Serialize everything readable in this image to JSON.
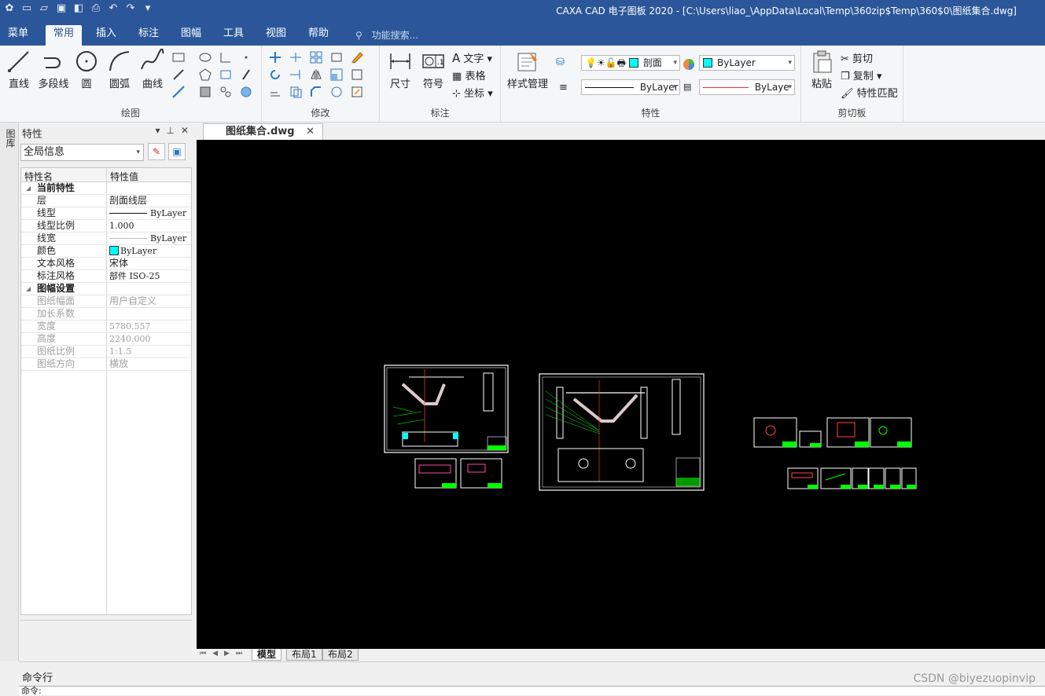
{
  "titlebar": {
    "title": "CAXA CAD 电子图板 2020 - [C:\\Users\\liao_\\AppData\\Local\\Temp\\360zip$Temp\\360$0\\图纸集合.dwg]",
    "quick_access": [
      "new-icon",
      "open-icon",
      "save-icon",
      "save-as-icon",
      "print-icon",
      "undo-icon",
      "redo-icon",
      "customize-icon"
    ]
  },
  "ribbon_tabs": {
    "items": [
      "菜单",
      "常用",
      "插入",
      "标注",
      "图幅",
      "工具",
      "视图",
      "帮助"
    ],
    "active": "常用",
    "search_placeholder": "功能搜索..."
  },
  "ribbon": {
    "draw": {
      "label": "绘图",
      "buttons": [
        "直线",
        "多段线",
        "圆",
        "圆弧",
        "曲线"
      ]
    },
    "modify": {
      "label": "修改"
    },
    "annotate": {
      "label": "标注",
      "dim": "尺寸",
      "symbol": "符号",
      "text": "文字",
      "table": "表格",
      "coord": "坐标"
    },
    "properties": {
      "label": "特性",
      "style_manager": "样式管理",
      "layer": "剖面",
      "color": "ByLayer",
      "linetype": "ByLayer",
      "lineweight": "ByLaye"
    },
    "clipboard": {
      "label": "剪切板",
      "paste": "粘贴",
      "cut": "剪切",
      "copy": "复制",
      "match": "特性匹配"
    }
  },
  "leftstrip": {
    "label": "图库"
  },
  "props_panel": {
    "title": "特性",
    "combo": "全局信息",
    "col_name": "特性名",
    "col_value": "特性值",
    "rows": [
      {
        "k": "当前特性",
        "sec": true
      },
      {
        "k": "层",
        "v": "剖面线层"
      },
      {
        "k": "线型",
        "v": "ByLayer"
      },
      {
        "k": "线型比例",
        "v": "1.000"
      },
      {
        "k": "线宽",
        "v": "ByLayer"
      },
      {
        "k": "颜色",
        "v": "ByLayer"
      },
      {
        "k": "文本风格",
        "v": "宋体"
      },
      {
        "k": "标注风格",
        "v": "部件 ISO-25"
      },
      {
        "k": "图幅设置",
        "sec": true
      },
      {
        "k": "图纸幅面",
        "v": "用户自定义",
        "dim": true
      },
      {
        "k": "加长系数",
        "v": "",
        "dim": true
      },
      {
        "k": "宽度",
        "v": "5780.557",
        "dim": true
      },
      {
        "k": "高度",
        "v": "2240.000",
        "dim": true
      },
      {
        "k": "图纸比例",
        "v": "1:1.5",
        "dim": true
      },
      {
        "k": "图纸方向",
        "v": "横放",
        "dim": true
      }
    ]
  },
  "document": {
    "tab": "图纸集合.dwg"
  },
  "layout_tabs": [
    "模型",
    "布局1",
    "布局2"
  ],
  "command": {
    "label": "命令行",
    "prompt": "命令:"
  },
  "watermark": "CSDN @biyezuopinvip",
  "colors": {
    "ribbon_blue": "#2b579a",
    "canvas": "#000000",
    "bylayer_cyan": "#00ffff"
  }
}
